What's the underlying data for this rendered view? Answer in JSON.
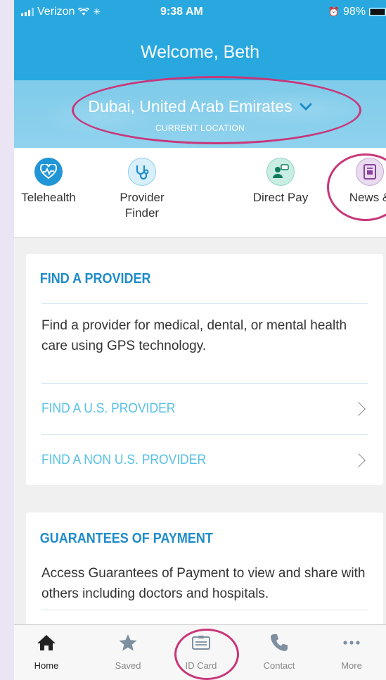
{
  "status_bar": {
    "carrier": "Verizon",
    "time": "9:38 AM",
    "battery": "98%"
  },
  "header": {
    "title": "Welcome, Beth"
  },
  "location": {
    "name": "Dubai, United Arab Emirates",
    "label": "CURRENT LOCATION"
  },
  "tiles": [
    {
      "label": "Telehealth",
      "icon": "heartbeat-icon"
    },
    {
      "label": "Provider Finder",
      "icon": "stethoscope-icon"
    },
    {
      "label": "Direct Pay",
      "icon": "chat-person-icon"
    },
    {
      "label": "News &",
      "icon": "newspaper-icon"
    }
  ],
  "cards": {
    "find_provider": {
      "title": "FIND A PROVIDER",
      "description": "Find a provider for medical, dental, or mental health care using GPS technology.",
      "links": [
        "FIND A U.S. PROVIDER",
        "FIND A NON U.S. PROVIDER"
      ]
    },
    "guarantees": {
      "title": "GUARANTEES OF PAYMENT",
      "description": "Access Guarantees of Payment to view and share with others including doctors and hospitals."
    }
  },
  "tabbar": [
    {
      "label": "Home",
      "active": true
    },
    {
      "label": "Saved"
    },
    {
      "label": "ID Card"
    },
    {
      "label": "Contact"
    },
    {
      "label": "More"
    }
  ],
  "colors": {
    "header_blue": "#29a8e0",
    "accent_blue": "#1f8ccb",
    "link_blue": "#56c0e6",
    "highlight_magenta": "#c8377a"
  }
}
